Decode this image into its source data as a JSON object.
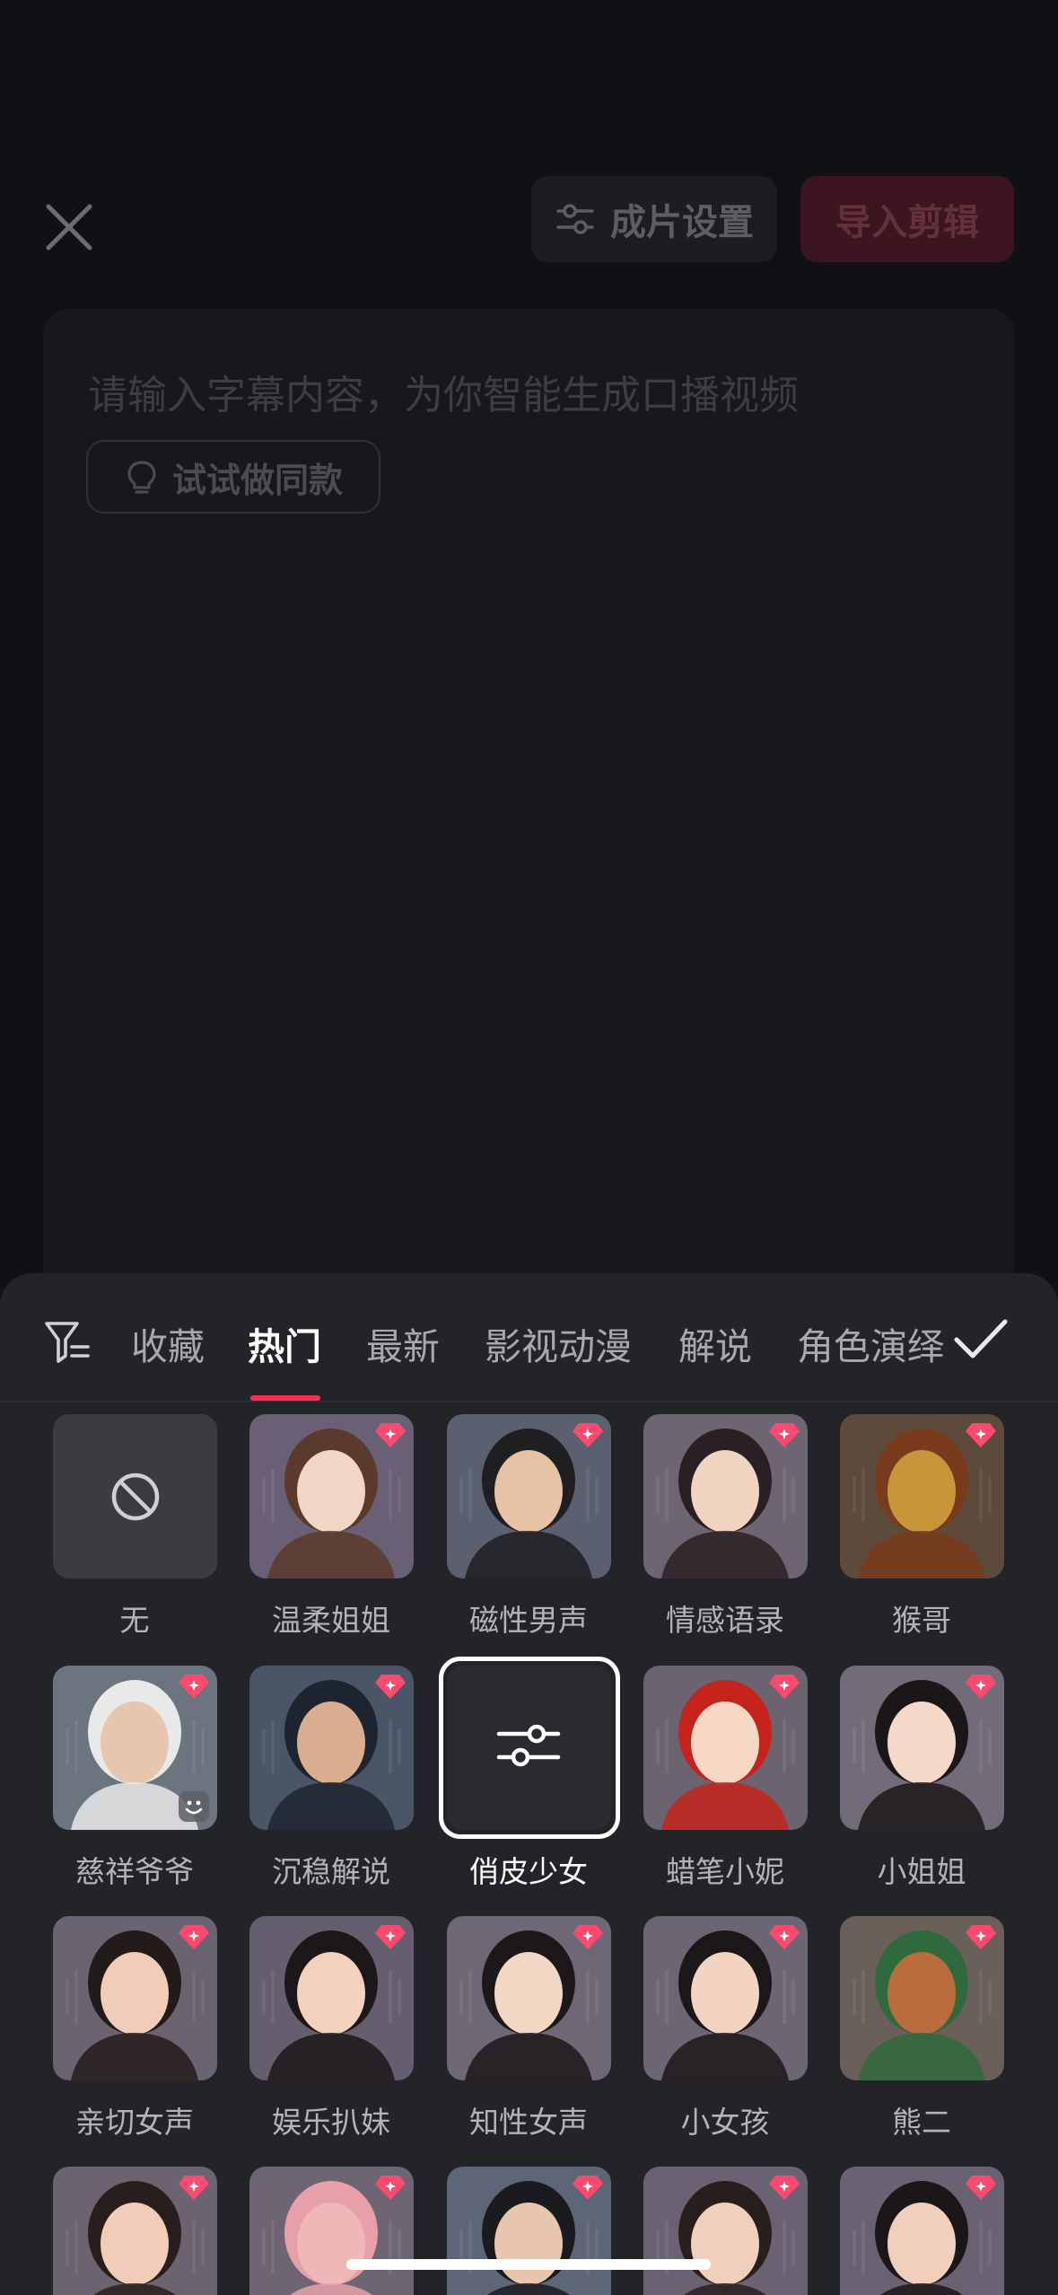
{
  "header": {
    "settings_label": "成片设置",
    "import_label": "导入剪辑"
  },
  "editor": {
    "placeholder": "请输入字幕内容，为你智能生成口播视频",
    "try_label": "试试做同款"
  },
  "voice_sheet": {
    "tabs": [
      {
        "label": "收藏",
        "active": false
      },
      {
        "label": "热门",
        "active": true
      },
      {
        "label": "最新",
        "active": false
      },
      {
        "label": "影视动漫",
        "active": false
      },
      {
        "label": "解说",
        "active": false
      },
      {
        "label": "角色演绎",
        "active": false
      }
    ],
    "voices": [
      {
        "name": "无",
        "icon": "none-icon"
      },
      {
        "name": "温柔姐姐",
        "badge": "gem-icon"
      },
      {
        "name": "磁性男声",
        "badge": "gem-icon"
      },
      {
        "name": "情感语录",
        "badge": "gem-icon"
      },
      {
        "name": "猴哥",
        "badge": "gem-icon"
      },
      {
        "name": "慈祥爷爷",
        "badge": "gem-icon"
      },
      {
        "name": "沉稳解说",
        "badge": "gem-icon"
      },
      {
        "name": "俏皮少女",
        "selected": true,
        "icon": "adjust-icon"
      },
      {
        "name": "蜡笔小妮",
        "badge": "gem-icon"
      },
      {
        "name": "小姐姐",
        "badge": "gem-icon"
      },
      {
        "name": "亲切女声",
        "badge": "gem-icon"
      },
      {
        "name": "娱乐扒妹",
        "badge": "gem-icon"
      },
      {
        "name": "知性女声",
        "badge": "gem-icon"
      },
      {
        "name": "小女孩",
        "badge": "gem-icon"
      },
      {
        "name": "熊二",
        "badge": "gem-icon"
      },
      {
        "name": "",
        "badge": "gem-icon"
      },
      {
        "name": "",
        "badge": "gem-icon"
      },
      {
        "name": "",
        "badge": "gem-icon"
      },
      {
        "name": "",
        "badge": "gem-icon"
      },
      {
        "name": "",
        "badge": "gem-icon"
      }
    ]
  },
  "colors": {
    "accent": "#fe2c55",
    "background": "#121316",
    "sheet": "#232427"
  }
}
